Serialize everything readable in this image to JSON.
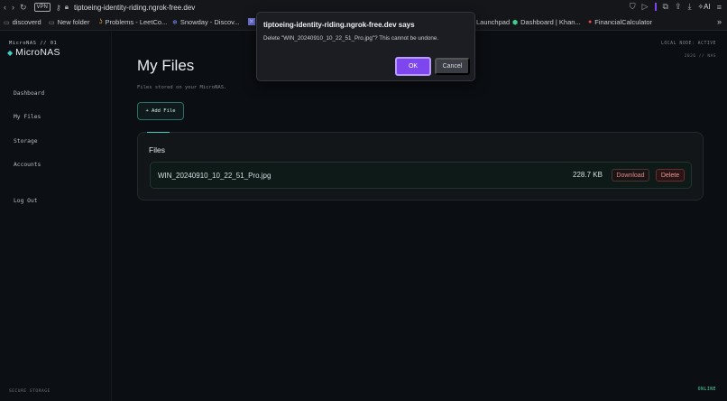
{
  "browser": {
    "vpn_label": "VPN",
    "url": "tiptoeing-identity-riding.ngrok-free.dev",
    "ai_label": "AI",
    "bookmarks": [
      {
        "label": "discoverd"
      },
      {
        "label": "New folder"
      },
      {
        "label": "Problems - LeetCo..."
      },
      {
        "label": "Snowday - Discov..."
      },
      {
        "label": "Launchpad"
      },
      {
        "label": "Dashboard | Khan..."
      },
      {
        "label": "FinancialCalculator"
      }
    ]
  },
  "sidebar": {
    "brand_sub": "MicroNAS // 01",
    "brand_name": "MicroNAS",
    "items": [
      {
        "label": "Dashboard"
      },
      {
        "label": "My Files"
      },
      {
        "label": "Storage"
      },
      {
        "label": "Accounts"
      },
      {
        "label": "Log Out"
      }
    ],
    "footer": "SECURE STORAGE"
  },
  "main": {
    "status": "LOCAL NODE: ACTIVE",
    "sub_status": "2026 // NAS",
    "title": "My Files",
    "subtitle": "Files stored on your MicroNAS.",
    "add_button": "+ Add File",
    "panel_title": "Files",
    "files": [
      {
        "name": "WIN_20240910_10_22_51_Pro.jpg",
        "size": "228.7 KB",
        "download_label": "Download",
        "delete_label": "Delete"
      }
    ],
    "online": "ONLINE"
  },
  "dialog": {
    "title": "tiptoeing-identity-riding.ngrok-free.dev says",
    "message": "Delete \"WIN_20240910_10_22_51_Pro.jpg\"? This cannot be undone.",
    "ok_label": "OK",
    "cancel_label": "Cancel"
  },
  "colors": {
    "accent": "#3fd0c0",
    "dialog_ok": "#7d46ee",
    "danger": "#e39a97",
    "online": "#4fd7a5"
  }
}
